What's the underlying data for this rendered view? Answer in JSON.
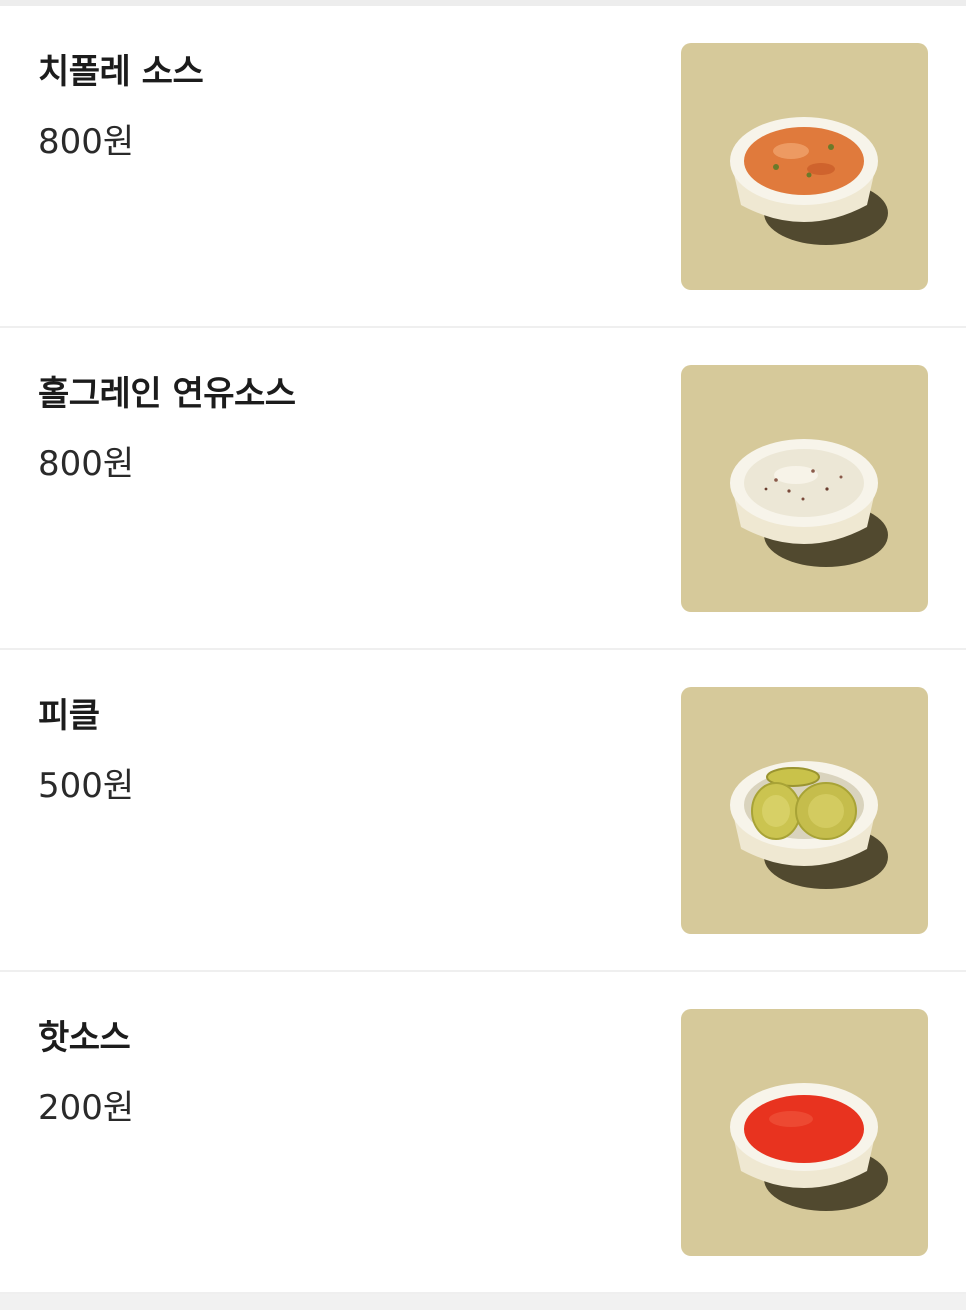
{
  "menu": {
    "items": [
      {
        "name": "치폴레 소스",
        "price": "800원",
        "image": "chipotle-sauce-bowl",
        "sauce_color": "#e07a3c"
      },
      {
        "name": "홀그레인 연유소스",
        "price": "800원",
        "image": "whole-grain-condensed-milk-sauce-bowl",
        "sauce_color": "#ece7d6"
      },
      {
        "name": "피클",
        "price": "500원",
        "image": "pickle-bowl",
        "sauce_color": "#c9c24a"
      },
      {
        "name": "핫소스",
        "price": "200원",
        "image": "hot-sauce-bowl",
        "sauce_color": "#e8331f"
      }
    ]
  },
  "colors": {
    "image_background": "#d6c99a",
    "bowl": "#f5f1e4",
    "divider": "#efefef"
  }
}
